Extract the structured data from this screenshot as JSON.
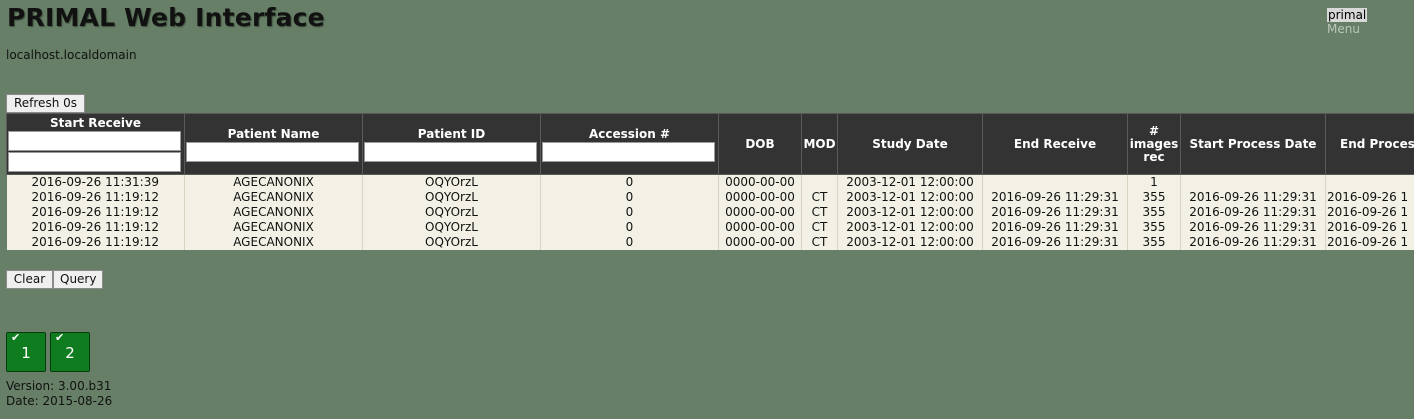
{
  "header": {
    "title": "PRIMAL Web Interface",
    "hostname": "localhost.localdomain",
    "user": "primal",
    "menu_label": "Menu"
  },
  "toolbar": {
    "refresh_label": "Refresh 0s"
  },
  "table": {
    "columns": [
      "Start Receive",
      "Patient Name",
      "Patient ID",
      "Accession #",
      "DOB",
      "MOD",
      "Study Date",
      "End Receive",
      "# images rec",
      "Start Process Date",
      "End Proces"
    ],
    "rows": [
      [
        "2016-09-26 11:31:39",
        "AGECANONIX",
        "OQYOrzL",
        "0",
        "0000-00-00",
        "",
        "2003-12-01 12:00:00",
        "",
        "1",
        "",
        ""
      ],
      [
        "2016-09-26 11:19:12",
        "AGECANONIX",
        "OQYOrzL",
        "0",
        "0000-00-00",
        "CT",
        "2003-12-01 12:00:00",
        "2016-09-26 11:29:31",
        "355",
        "2016-09-26 11:29:31",
        "2016-09-26 1"
      ],
      [
        "2016-09-26 11:19:12",
        "AGECANONIX",
        "OQYOrzL",
        "0",
        "0000-00-00",
        "CT",
        "2003-12-01 12:00:00",
        "2016-09-26 11:29:31",
        "355",
        "2016-09-26 11:29:31",
        "2016-09-26 1"
      ],
      [
        "2016-09-26 11:19:12",
        "AGECANONIX",
        "OQYOrzL",
        "0",
        "0000-00-00",
        "CT",
        "2003-12-01 12:00:00",
        "2016-09-26 11:29:31",
        "355",
        "2016-09-26 11:29:31",
        "2016-09-26 1"
      ],
      [
        "2016-09-26 11:19:12",
        "AGECANONIX",
        "OQYOrzL",
        "0",
        "0000-00-00",
        "CT",
        "2003-12-01 12:00:00",
        "2016-09-26 11:29:31",
        "355",
        "2016-09-26 11:29:31",
        "2016-09-26 1"
      ]
    ]
  },
  "actions": {
    "clear_label": "Clear",
    "query_label": "Query"
  },
  "tiles": [
    {
      "label": "1",
      "icon": "checkmark-icon"
    },
    {
      "label": "2",
      "icon": "checkmark-icon"
    }
  ],
  "footer": {
    "version": "Version: 3.00.b31",
    "date": "Date: 2015-08-26"
  },
  "colors": {
    "background": "#667f66",
    "header_bg": "#333333",
    "row_bg": "#f3f1e5",
    "tile_green": "#0f7d1f"
  }
}
